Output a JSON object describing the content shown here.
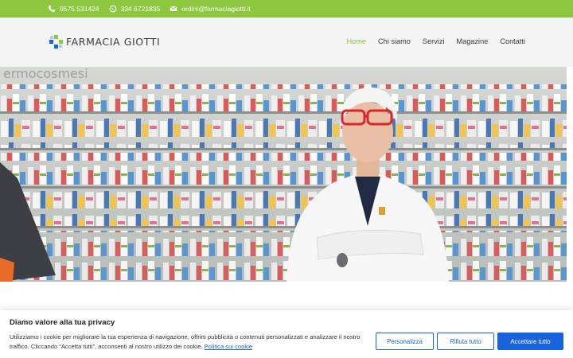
{
  "topbar": {
    "phone": "0575.531424",
    "whatsapp": "334.6721835",
    "email": "ordini@farmaciagiotti.it"
  },
  "header": {
    "brand": "FARMACIA GIOTTI",
    "nav": [
      {
        "label": "Home",
        "active": true
      },
      {
        "label": "Chi siamo",
        "active": false
      },
      {
        "label": "Servizi",
        "active": false
      },
      {
        "label": "Magazine",
        "active": false
      },
      {
        "label": "Contatti",
        "active": false
      }
    ]
  },
  "hero": {
    "sign_text": "ermocosmesi"
  },
  "cookie_banner": {
    "title": "Diamo valore alla tua privacy",
    "text": "Utilizziamo i cookie per migliorare la tua esperienza di navigazione, offrirti pubblicità o contenuti personalizzati e analizzare il nostro traffico. Cliccando “Accetta tutti”, acconsenti al nostro utilizzo dei cookie.",
    "policy_link": "Politica sui cookie",
    "customize_label": "Personalizza",
    "reject_label": "Rifiuta tutto",
    "accept_label": "Accettare tutto"
  },
  "colors": {
    "brand_green": "#8dc63f",
    "brand_blue": "#1863dc"
  },
  "icons": [
    "phone-icon",
    "whatsapp-icon",
    "email-icon",
    "pharmacy-cross-logo"
  ]
}
